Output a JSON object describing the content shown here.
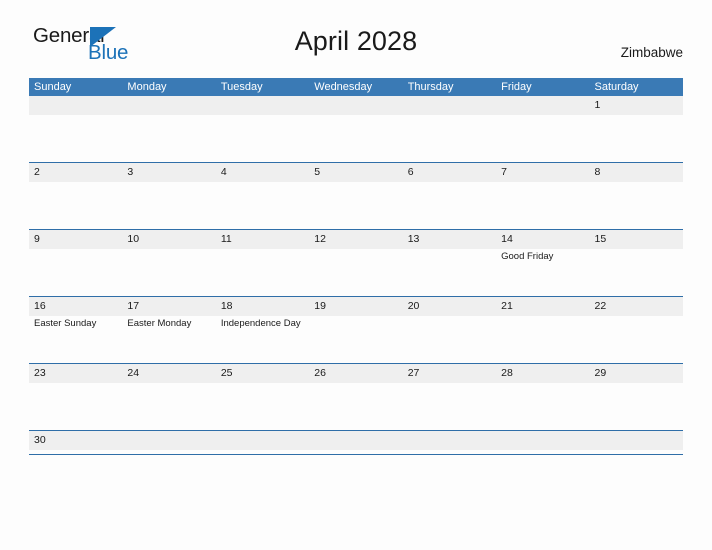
{
  "logo": {
    "text_primary": "General",
    "text_secondary": "Blue",
    "triangle_color": "#1c72b8"
  },
  "header": {
    "title": "April 2028",
    "country": "Zimbabwe"
  },
  "theme": {
    "header_blue": "#3a7ab5",
    "rule_blue": "#2f6ea8",
    "day_band_gray": "#efefef",
    "page_background": "#fdfdfd",
    "text_color": "#1a1a1a"
  },
  "calendar": {
    "month": "April",
    "year": "2028",
    "weekdays": [
      "Sunday",
      "Monday",
      "Tuesday",
      "Wednesday",
      "Thursday",
      "Friday",
      "Saturday"
    ],
    "weeks": [
      {
        "days": [
          {
            "date": "",
            "events": []
          },
          {
            "date": "",
            "events": []
          },
          {
            "date": "",
            "events": []
          },
          {
            "date": "",
            "events": []
          },
          {
            "date": "",
            "events": []
          },
          {
            "date": "",
            "events": []
          },
          {
            "date": "1",
            "events": []
          }
        ]
      },
      {
        "days": [
          {
            "date": "2",
            "events": []
          },
          {
            "date": "3",
            "events": []
          },
          {
            "date": "4",
            "events": []
          },
          {
            "date": "5",
            "events": []
          },
          {
            "date": "6",
            "events": []
          },
          {
            "date": "7",
            "events": []
          },
          {
            "date": "8",
            "events": []
          }
        ]
      },
      {
        "days": [
          {
            "date": "9",
            "events": []
          },
          {
            "date": "10",
            "events": []
          },
          {
            "date": "11",
            "events": []
          },
          {
            "date": "12",
            "events": []
          },
          {
            "date": "13",
            "events": []
          },
          {
            "date": "14",
            "events": [
              "Good Friday"
            ]
          },
          {
            "date": "15",
            "events": []
          }
        ]
      },
      {
        "days": [
          {
            "date": "16",
            "events": [
              "Easter Sunday"
            ]
          },
          {
            "date": "17",
            "events": [
              "Easter Monday"
            ]
          },
          {
            "date": "18",
            "events": [
              "Independence Day"
            ]
          },
          {
            "date": "19",
            "events": []
          },
          {
            "date": "20",
            "events": []
          },
          {
            "date": "21",
            "events": []
          },
          {
            "date": "22",
            "events": []
          }
        ]
      },
      {
        "days": [
          {
            "date": "23",
            "events": []
          },
          {
            "date": "24",
            "events": []
          },
          {
            "date": "25",
            "events": []
          },
          {
            "date": "26",
            "events": []
          },
          {
            "date": "27",
            "events": []
          },
          {
            "date": "28",
            "events": []
          },
          {
            "date": "29",
            "events": []
          }
        ]
      },
      {
        "days": [
          {
            "date": "30",
            "events": []
          },
          {
            "date": "",
            "events": []
          },
          {
            "date": "",
            "events": []
          },
          {
            "date": "",
            "events": []
          },
          {
            "date": "",
            "events": []
          },
          {
            "date": "",
            "events": []
          },
          {
            "date": "",
            "events": []
          }
        ]
      }
    ]
  }
}
